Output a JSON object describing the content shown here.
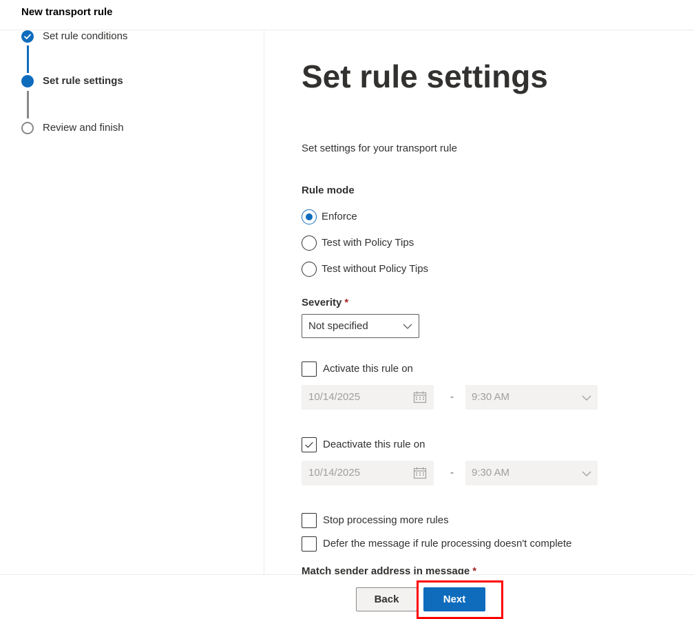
{
  "header": {
    "title": "New transport rule"
  },
  "wizard": {
    "steps": [
      {
        "label": "Set rule conditions",
        "state": "done"
      },
      {
        "label": "Set rule settings",
        "state": "current"
      },
      {
        "label": "Review and finish",
        "state": "todo"
      }
    ]
  },
  "main": {
    "title": "Set rule settings",
    "subtitle": "Set settings for your transport rule",
    "rule_mode": {
      "label": "Rule mode",
      "options": [
        "Enforce",
        "Test with Policy Tips",
        "Test without Policy Tips"
      ],
      "selected": "Enforce"
    },
    "severity": {
      "label": "Severity",
      "required_mark": "*",
      "value": "Not specified"
    },
    "activate": {
      "label": "Activate this rule on",
      "checked": false,
      "date": "10/14/2025",
      "time": "9:30 AM"
    },
    "deactivate": {
      "label": "Deactivate this rule on",
      "checked": true,
      "date": "10/14/2025",
      "time": "9:30 AM"
    },
    "dash": "-",
    "stop_processing": {
      "label": "Stop processing more rules",
      "checked": false
    },
    "defer": {
      "label": "Defer the message if rule processing doesn't complete",
      "checked": false
    },
    "match_sender": {
      "label": "Match sender address in message",
      "required_mark": "*"
    }
  },
  "footer": {
    "back_label": "Back",
    "next_label": "Next"
  },
  "colors": {
    "accent": "#0f6cbd",
    "highlight": "#ff0000",
    "required": "#a4262c"
  },
  "icons": [
    "check-icon",
    "chevron-down-icon",
    "calendar-icon"
  ]
}
